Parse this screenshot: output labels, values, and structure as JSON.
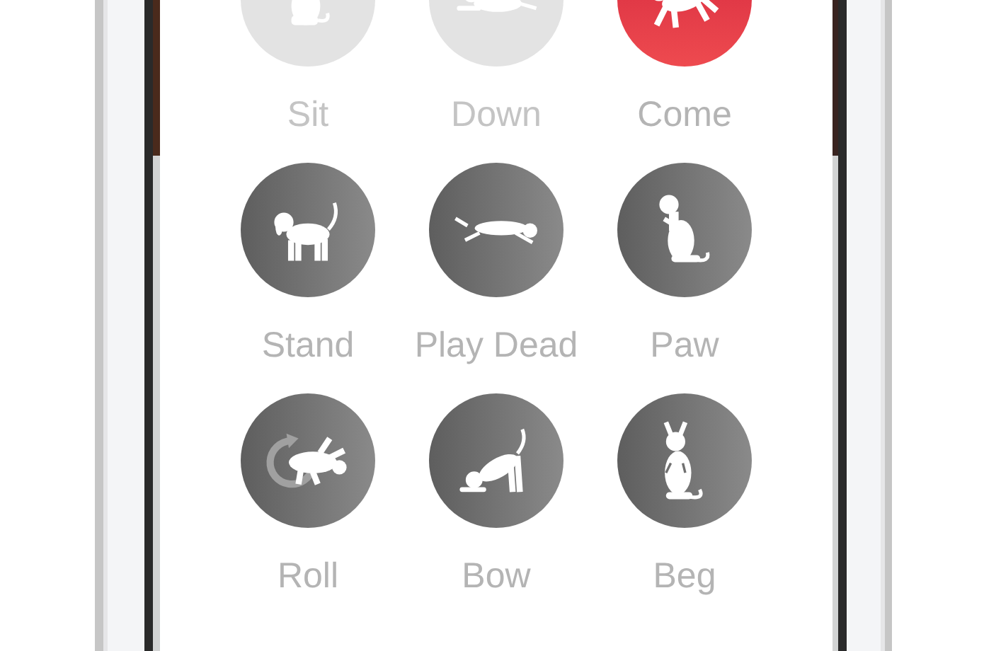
{
  "tricks": [
    {
      "label": "Sit",
      "selected": false,
      "disabled": true
    },
    {
      "label": "Down",
      "selected": false,
      "disabled": true
    },
    {
      "label": "Come",
      "selected": true,
      "disabled": false
    },
    {
      "label": "Stand",
      "selected": false,
      "disabled": false
    },
    {
      "label": "Play Dead",
      "selected": false,
      "disabled": false
    },
    {
      "label": "Paw",
      "selected": false,
      "disabled": false
    },
    {
      "label": "Roll",
      "selected": false,
      "disabled": false
    },
    {
      "label": "Bow",
      "selected": false,
      "disabled": false
    },
    {
      "label": "Beg",
      "selected": false,
      "disabled": false
    }
  ]
}
